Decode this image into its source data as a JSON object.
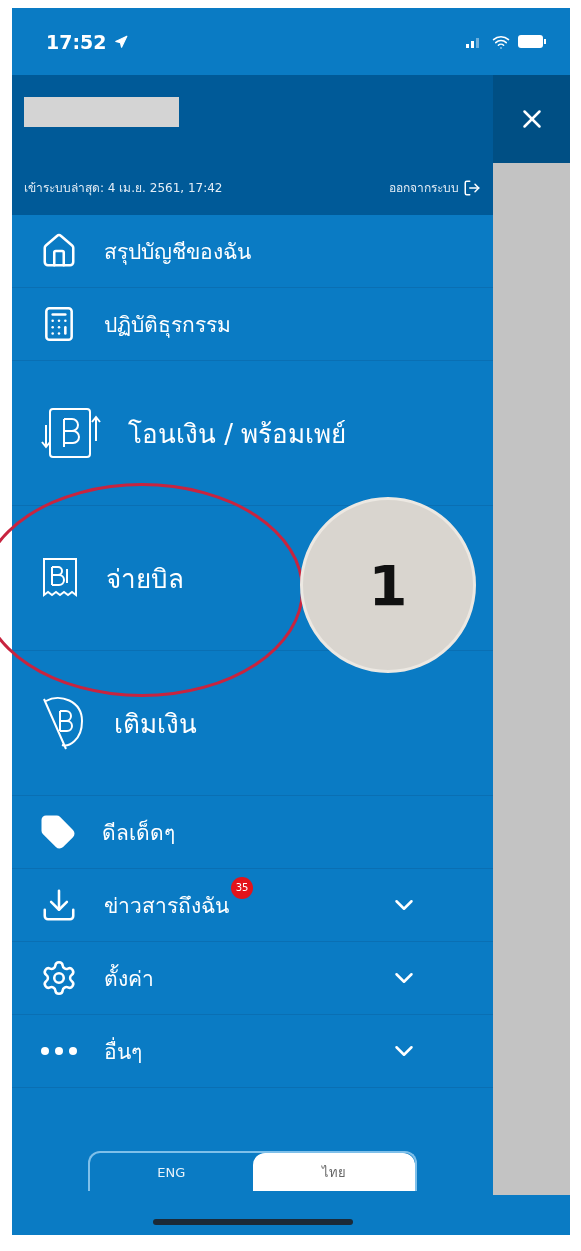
{
  "status_bar": {
    "time": "17:52"
  },
  "header": {
    "last_login": "เข้าระบบล่าสุด: 4 เม.ย. 2561, 17:42",
    "logout": "ออกจากระบบ"
  },
  "menu": [
    {
      "label": "สรุปบัญชีของฉัน",
      "kind": "small"
    },
    {
      "label": "ปฏิบัติธุรกรรม",
      "kind": "small"
    },
    {
      "label": "โอนเงิน / พร้อมเพย์",
      "kind": "large"
    },
    {
      "label": "จ่ายบิล",
      "kind": "large"
    },
    {
      "label": "เติมเงิน",
      "kind": "large"
    },
    {
      "label": "ดีลเด็ดๆ",
      "kind": "small"
    },
    {
      "label": "ข่าวสารถึงฉัน",
      "kind": "expandable",
      "badge": "35",
      "expanded": false
    },
    {
      "label": "ตั้งค่า",
      "kind": "expandable",
      "expanded": false
    },
    {
      "label": "อื่นๆ",
      "kind": "expandable",
      "expanded": false
    }
  ],
  "language_toggle": [
    {
      "label": "ENG",
      "selected": false
    },
    {
      "label": "ไทย",
      "selected": true
    }
  ],
  "annotation": {
    "number": "1"
  }
}
